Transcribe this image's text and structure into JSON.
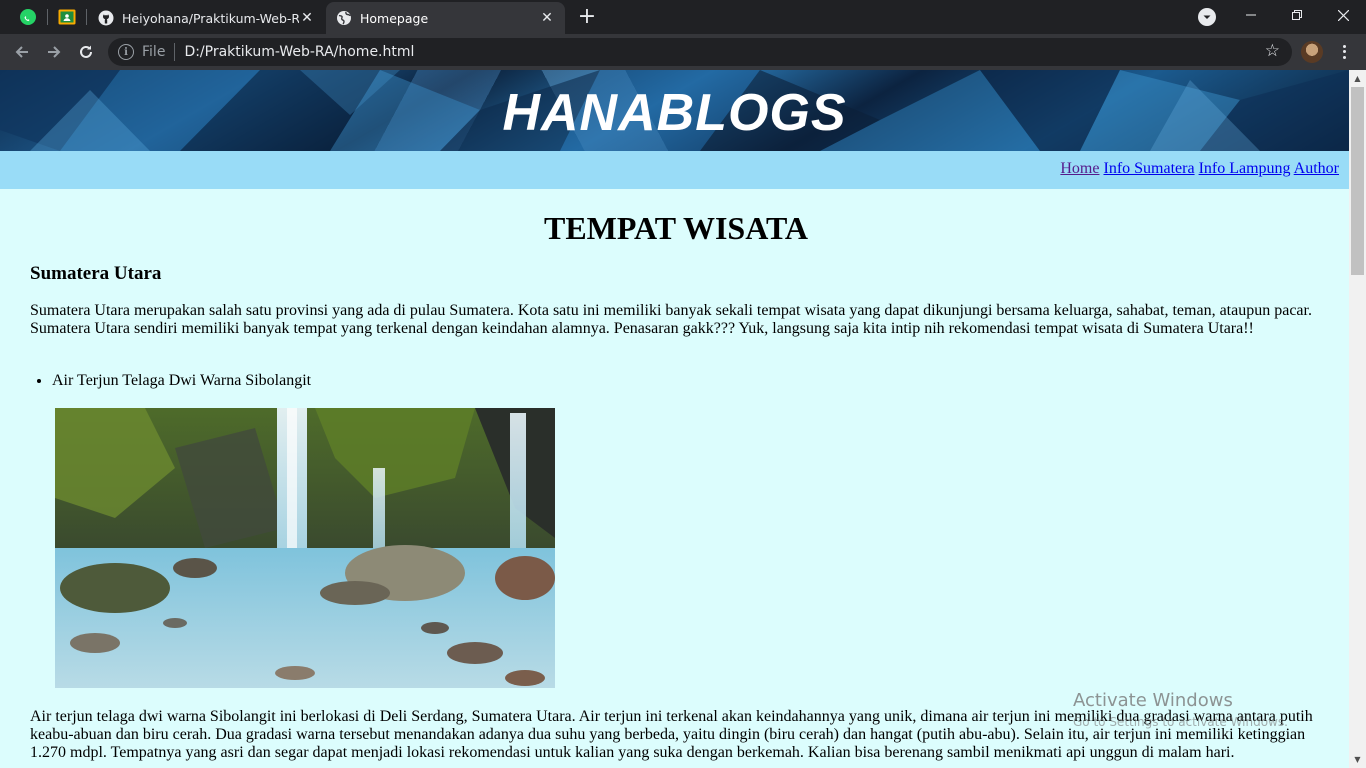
{
  "browser": {
    "tabs": [
      {
        "title": "Heiyohana/Praktikum-Web-RA at",
        "icon": "github-icon",
        "active": false
      },
      {
        "title": "Homepage",
        "icon": "globe-icon",
        "active": true
      }
    ],
    "pinned_tabs": [
      "whatsapp-icon",
      "google-classroom-icon"
    ],
    "address": {
      "scheme_label": "File",
      "url": "D:/Praktikum-Web-RA/home.html"
    }
  },
  "page": {
    "banner_title": "HANABLOGS",
    "nav_links": [
      "Home",
      "Info Sumatera",
      "Info Lampung",
      "Author"
    ],
    "heading": "TEMPAT WISATA",
    "section_title": "Sumatera Utara",
    "intro": "Sumatera Utara merupakan salah satu provinsi yang ada di pulau Sumatera. Kota satu ini memiliki banyak sekali tempat wisata yang dapat dikunjungi bersama keluarga, sahabat, teman, ataupun pacar. Sumatera Utara sendiri memiliki banyak tempat yang terkenal dengan keindahan alamnya. Penasaran gakk??? Yuk, langsung saja kita intip nih rekomendasi tempat wisata di Sumatera Utara!!",
    "list_items": [
      "Air Terjun Telaga Dwi Warna Sibolangit"
    ],
    "description": "Air terjun telaga dwi warna Sibolangit ini berlokasi di Deli Serdang, Sumatera Utara. Air terjun ini terkenal akan keindahannya yang unik, dimana air terjun ini memiliki dua gradasi warna antara putih keabu-abuan dan biru cerah. Dua gradasi warna tersebut menandakan adanya dua suhu yang berbeda, yaitu dingin (biru cerah) dan hangat (putih abu-abu). Selain itu, air terjun ini memiliki ketinggian 1.270 mdpl. Tempatnya yang asri dan segar dapat menjadi lokasi rekomendasi untuk kalian yang suka dengan berkemah. Kalian bisa berenang sambil menikmati api unggun di malam hari."
  },
  "overlay": {
    "activate_title": "Activate Windows",
    "activate_sub": "Go to Settings to activate Windows."
  }
}
